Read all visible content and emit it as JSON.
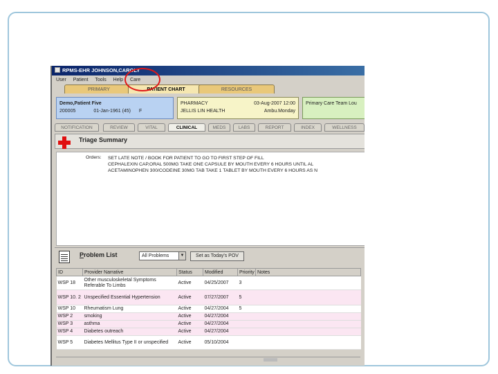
{
  "window": {
    "title": "RPMS-EHR JOHNSON,CAROLY"
  },
  "menu": [
    "User",
    "Patient",
    "Tools",
    "Help",
    "Care"
  ],
  "top_tabs": [
    "PRIMARY",
    "PATIENT CHART",
    "RESOURCES"
  ],
  "patient": {
    "name": "Demo,Patient Five",
    "chart_no": "200005",
    "dob": "01-Jan-1961 (45)",
    "sex": "F"
  },
  "pharmacy": {
    "title": "PHARMACY",
    "datetime": "03-Aug-2007 12:00",
    "location": "JELLIS LIN HEALTH",
    "provider": "Ambu.Monday"
  },
  "care_team": {
    "label": "Primary Care Team Lou"
  },
  "sub_tabs": [
    "NOTIFICATION",
    "REVIEW",
    "VITAL",
    "CLINICAL",
    "MEDS",
    "LABS",
    "REPORT",
    "INDEX",
    "WELLNESS"
  ],
  "triage": {
    "title": "Triage Summary"
  },
  "orders": {
    "label": "Orders:",
    "lines": [
      "SET LATE NOTE / BOOK FOR PATIENT TO GO TO FIRST STEP OF FILL",
      "CEPHALEXIN CAP,ORAL 500MG TAKE ONE CAPSULE BY MOUTH EVERY 6 HOURS UNTIL AL",
      "ACETAMINOPHEN 300/CODEINE 30MG TAB TAKE 1 TABLET BY MOUTH EVERY 6 HOURS AS N"
    ]
  },
  "problem_list": {
    "title": "Problem List",
    "filter": "All Problems",
    "pov_button": "Set as Today's POV",
    "columns": [
      "ID",
      "Provider Narrative",
      "Status",
      "Modified",
      "Priority",
      "Notes"
    ],
    "rows": [
      {
        "id": "WSP 18",
        "narrative": "Other musculoskeletal Symptoms Referable To Limbs",
        "status": "Active",
        "modified": "04/25/2007",
        "priority": "3",
        "notes": ""
      },
      {
        "id": "WSP 10. 2",
        "narrative": "Unspecified Essential Hypertension",
        "status": "Active",
        "modified": "07/27/2007",
        "priority": "5",
        "notes": ""
      },
      {
        "id": "WSP 10",
        "narrative": "Rheumatism Lung",
        "status": "Active",
        "modified": "04/27/2004",
        "priority": "5",
        "notes": ""
      },
      {
        "id": "WSP 2",
        "narrative": "smoking",
        "status": "Active",
        "modified": "04/27/2004",
        "priority": "",
        "notes": ""
      },
      {
        "id": "WSP 3",
        "narrative": "asthma",
        "status": "Active",
        "modified": "04/27/2004",
        "priority": "",
        "notes": ""
      },
      {
        "id": "WSP 4",
        "narrative": "Diabetes outreach",
        "status": "Active",
        "modified": "04/27/2004",
        "priority": "",
        "notes": ""
      },
      {
        "id": "WSP 5",
        "narrative": "Diabetes Mellitus Type II or unspecified",
        "status": "Active",
        "modified": "05/10/2004",
        "priority": "",
        "notes": ""
      }
    ]
  },
  "colors": {
    "title_bar": "#0a246a",
    "highlight_circle": "#e01818",
    "patient_box": "#b9d2f2"
  }
}
